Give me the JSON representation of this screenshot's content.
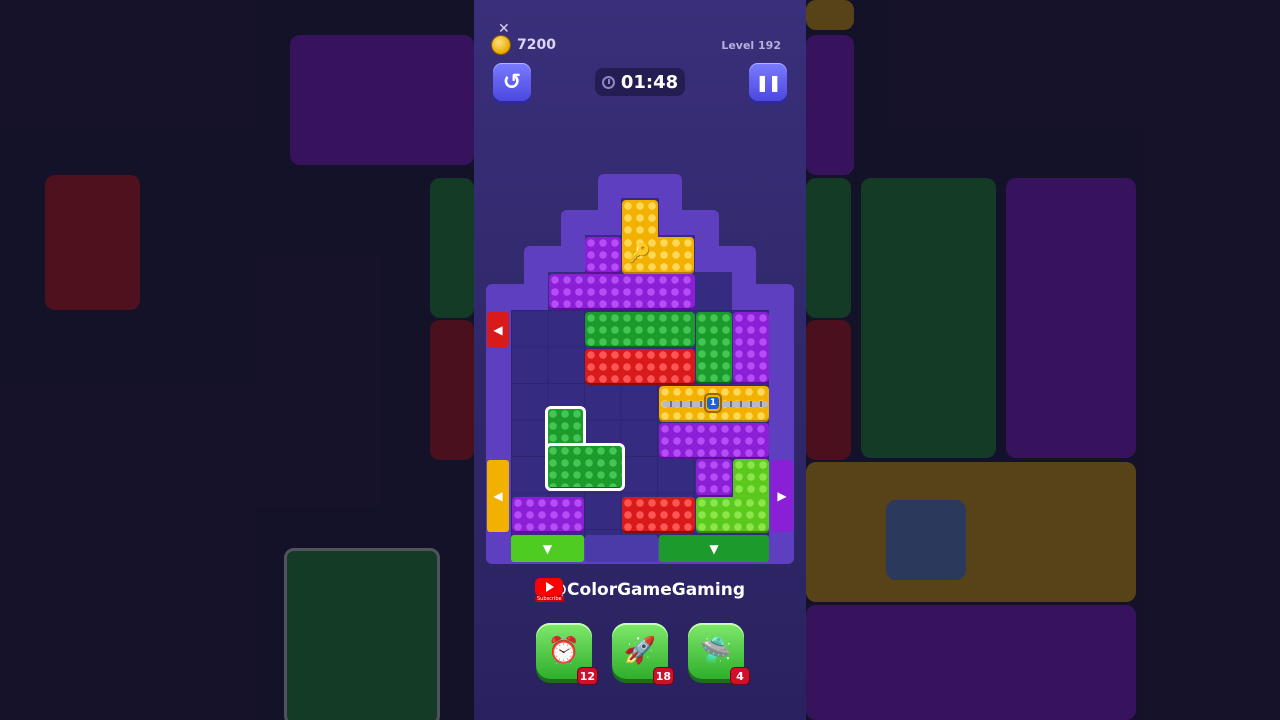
{
  "hud": {
    "coins": "7200",
    "level": "Level 192",
    "timer": "01:48",
    "undo_icon": "undo-icon",
    "pause_icon": "pause-icon"
  },
  "channel": {
    "name": "@ColorGameGaming",
    "subscribe_label": "Subscribe"
  },
  "lock": {
    "count": "1"
  },
  "boosters": [
    {
      "name": "clock-freeze",
      "icon": "alarm-clock-icon",
      "count": "12"
    },
    {
      "name": "rocket",
      "icon": "rocket-icon",
      "count": "18"
    },
    {
      "name": "ufo",
      "icon": "ufo-icon",
      "count": "4"
    }
  ],
  "colors": {
    "yellow": "#f2b000",
    "purple": "#8b1fd6",
    "green": "#1c9a2c",
    "lime": "#5bc81e",
    "red": "#d91a1a",
    "frame": "#5d3fbf"
  }
}
